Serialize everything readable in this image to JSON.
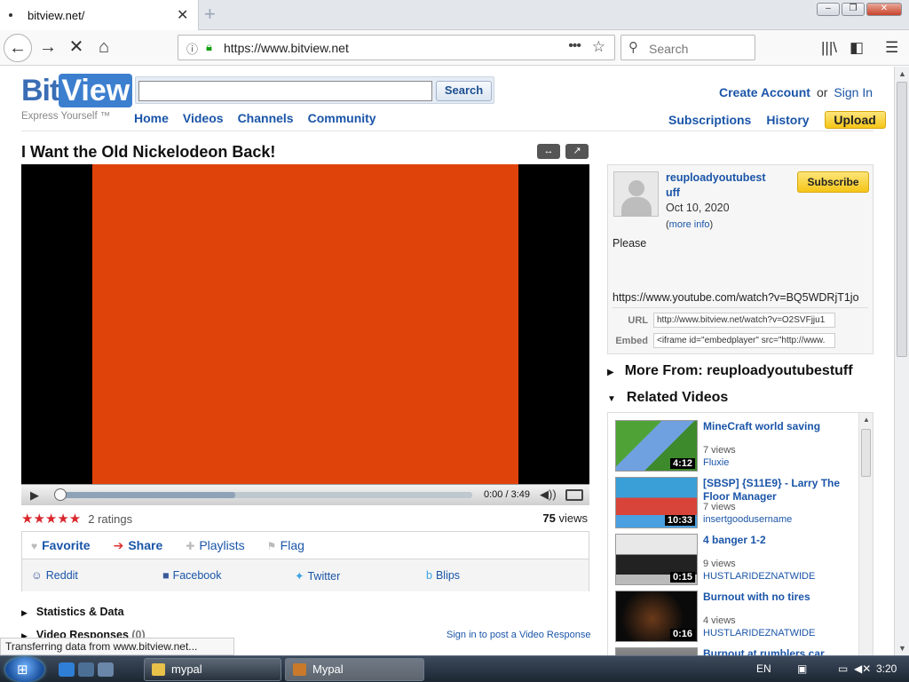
{
  "browser": {
    "tab_title": "bitview.net/",
    "url": "https://www.bitview.net",
    "search_placeholder": "Search",
    "status": "Transferring data from www.bitview.net..."
  },
  "site": {
    "logo_bit": "Bit",
    "logo_view": "View",
    "tagline": "Express Yourself ™",
    "search_button": "Search",
    "nav": [
      "Home",
      "Videos",
      "Channels",
      "Community"
    ],
    "create_account": "Create Account",
    "or": "or",
    "sign_in": "Sign In",
    "subscriptions": "Subscriptions",
    "history": "History",
    "upload": "Upload"
  },
  "video": {
    "title": "I Want the Old Nickelodeon Back!",
    "frame_color": "#e0430a",
    "time": "0:00 / 3:49",
    "progress_loaded": 0.43,
    "rating_stars": 5,
    "ratings": "2 ratings",
    "views_num": "75",
    "views_label": "views"
  },
  "actions": {
    "favorite": "Favorite",
    "share": "Share",
    "playlists": "Playlists",
    "flag": "Flag",
    "social": [
      "Reddit",
      "Facebook",
      "Twitter",
      "Blips"
    ]
  },
  "below": {
    "stats": "Statistics & Data",
    "responses": "Video Responses",
    "responses_count": "(0)",
    "sign_in_response": "Sign in to post a Video Response"
  },
  "info": {
    "uploader": "reuploadyoutubestuff",
    "date": "Oct 10, 2020",
    "more_info_open": "(",
    "more_info": "more info",
    "more_info_close": ")",
    "subscribe": "Subscribe",
    "description": "Please",
    "desc_link": "https://www.youtube.com/watch?v=BQ5WDRjT1jo",
    "url_label": "URL",
    "url_value": "http://www.bitview.net/watch?v=O2SVFjju1",
    "embed_label": "Embed",
    "embed_value": "<iframe id=\"embedplayer\" src=\"http://www."
  },
  "sections": {
    "more_from": "More From: reuploadyoutubestuff",
    "related": "Related Videos"
  },
  "related": [
    {
      "title": "MineCraft world saving",
      "views": "7 views",
      "author": "Fluxie",
      "duration": "4:12"
    },
    {
      "title": "[SBSP] {S11E9} - Larry The Floor Manager",
      "views": "7 views",
      "author": "insertgoodusername",
      "duration": "10:33"
    },
    {
      "title": "4 banger 1-2",
      "views": "9 views",
      "author": "HUSTLARIDEZNATWIDE",
      "duration": "0:15"
    },
    {
      "title": "Burnout with no tires",
      "views": "4 views",
      "author": "HUSTLARIDEZNATWIDE",
      "duration": "0:16"
    },
    {
      "title": "Burnout at rumblers car",
      "views": "",
      "author": "",
      "duration": ""
    }
  ],
  "taskbar": {
    "items": [
      "mypal",
      "Mypal"
    ],
    "lang": "EN",
    "clock": "3:20"
  }
}
